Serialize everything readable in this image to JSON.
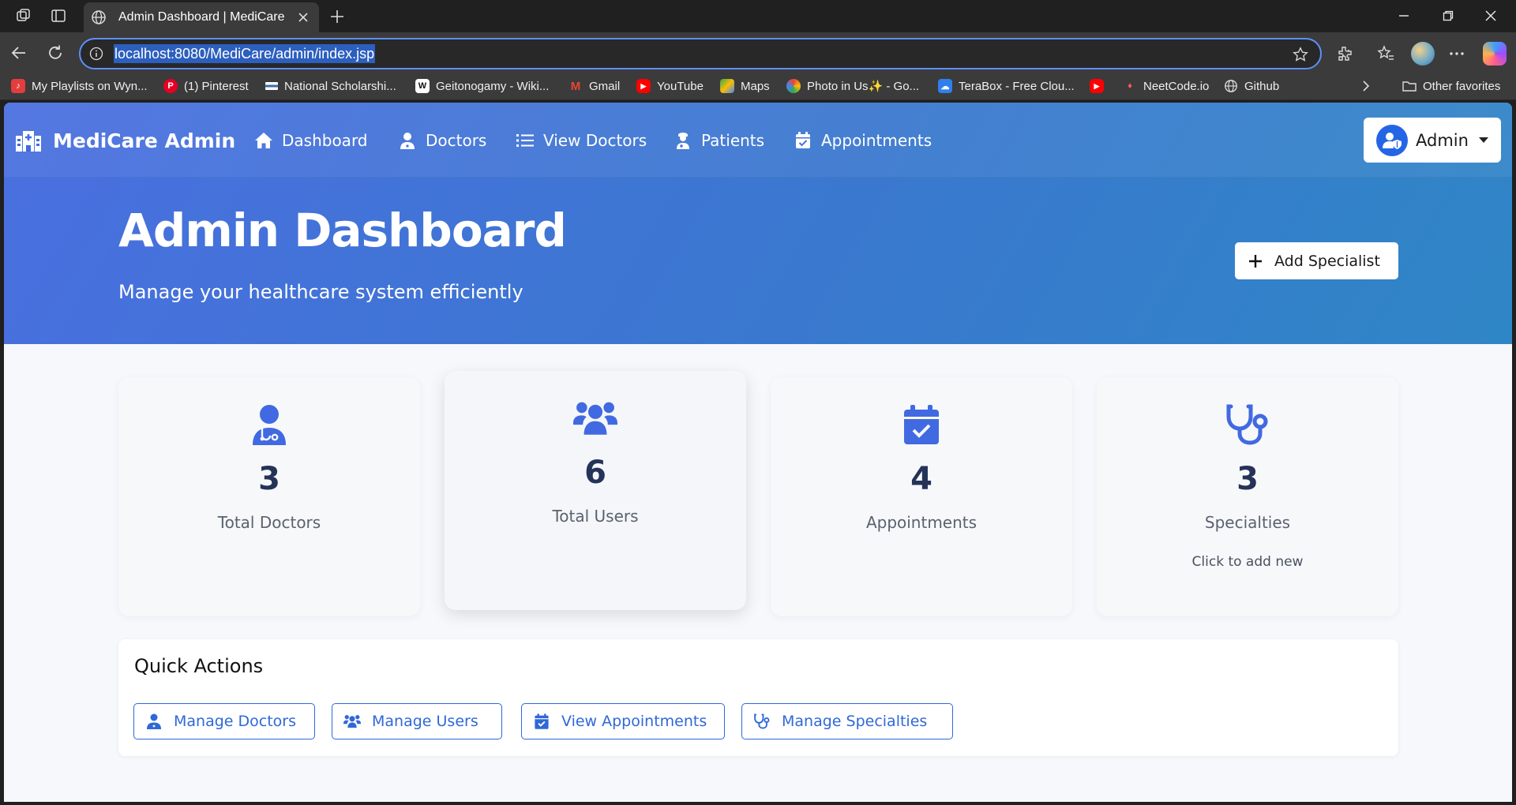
{
  "browser": {
    "tab_title": "Admin Dashboard | MediCare",
    "url": "localhost:8080/MediCare/admin/index.jsp",
    "bookmarks": [
      {
        "label": "My Playlists on Wyn...",
        "icon": "music-app-icon",
        "color": "#e43d3d"
      },
      {
        "label": "(1) Pinterest",
        "icon": "pinterest-icon",
        "color": "#e60023"
      },
      {
        "label": "National Scholarshi...",
        "icon": "gov-flag-icon",
        "color": "#3a6ea5"
      },
      {
        "label": "Geitonogamy - Wiki...",
        "icon": "wikipedia-icon",
        "color": "#ffffff"
      },
      {
        "label": "Gmail",
        "icon": "gmail-icon",
        "color": "#ea4335"
      },
      {
        "label": "YouTube",
        "icon": "youtube-icon",
        "color": "#ff0000"
      },
      {
        "label": "Maps",
        "icon": "maps-icon",
        "color": "#34a853"
      },
      {
        "label": "Photo in Us✨ - Go...",
        "icon": "photos-icon",
        "color": "#fbbc05"
      },
      {
        "label": "TeraBox - Free Clou...",
        "icon": "terabox-icon",
        "color": "#2f80ed"
      },
      {
        "label": "",
        "icon": "youtube-icon",
        "color": "#ff0000"
      },
      {
        "label": "NeetCode.io",
        "icon": "neetcode-icon",
        "color": "#555555"
      },
      {
        "label": "Github",
        "icon": "globe-icon",
        "color": "#3b3b3b"
      }
    ],
    "other_favorites": "Other favorites"
  },
  "app": {
    "brand": "MediCare Admin",
    "nav": [
      {
        "label": "Dashboard",
        "icon": "home-icon"
      },
      {
        "label": "Doctors",
        "icon": "user-doctor-icon"
      },
      {
        "label": "View Doctors",
        "icon": "list-icon"
      },
      {
        "label": "Patients",
        "icon": "patient-icon"
      },
      {
        "label": "Appointments",
        "icon": "calendar-check-icon"
      }
    ],
    "user_menu": "Admin",
    "accent": "#4169e1",
    "hero_gradient": [
      "#4a6fe0",
      "#2f86c6"
    ]
  },
  "hero": {
    "title": "Admin Dashboard",
    "subtitle": "Manage your healthcare system efficiently",
    "add_button": "Add Specialist"
  },
  "stats": [
    {
      "value": "3",
      "label": "Total Doctors",
      "icon": "user-doctor-icon"
    },
    {
      "value": "6",
      "label": "Total Users",
      "icon": "users-icon"
    },
    {
      "value": "4",
      "label": "Appointments",
      "icon": "calendar-check-icon"
    },
    {
      "value": "3",
      "label": "Specialties",
      "icon": "stethoscope-icon",
      "hint": "Click to add new"
    }
  ],
  "quick_actions": {
    "title": "Quick Actions",
    "buttons": [
      {
        "label": "Manage Doctors",
        "icon": "user-doctor-icon"
      },
      {
        "label": "Manage Users",
        "icon": "users-icon"
      },
      {
        "label": "View Appointments",
        "icon": "calendar-check-icon"
      },
      {
        "label": "Manage Specialties",
        "icon": "stethoscope-icon"
      }
    ]
  }
}
